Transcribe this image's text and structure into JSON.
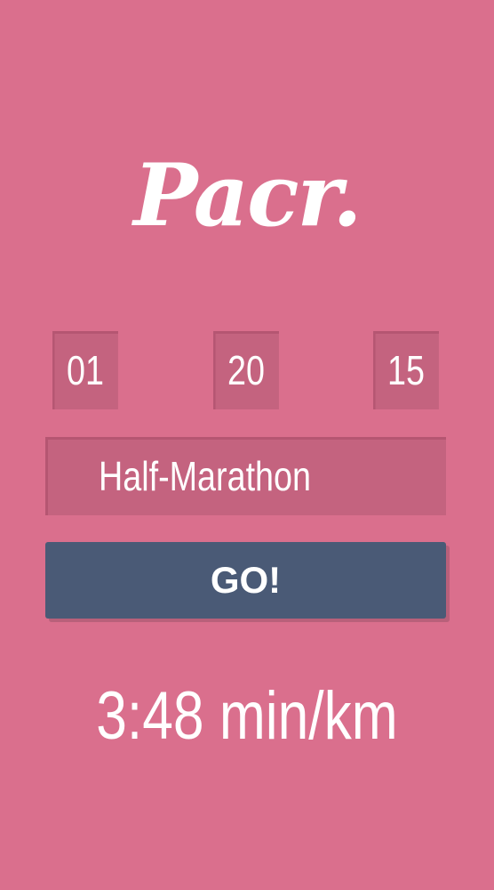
{
  "app": {
    "logo": "Pacr."
  },
  "time": {
    "hours": "01",
    "minutes": "20",
    "seconds": "15"
  },
  "distance": {
    "selected": "Half-Marathon"
  },
  "actions": {
    "go_label": "GO!"
  },
  "result": {
    "pace": "3:48 min/km"
  },
  "colors": {
    "background": "#da6f8d",
    "field": "#c4637f",
    "button": "#4a5a76",
    "text": "#ffffff"
  }
}
